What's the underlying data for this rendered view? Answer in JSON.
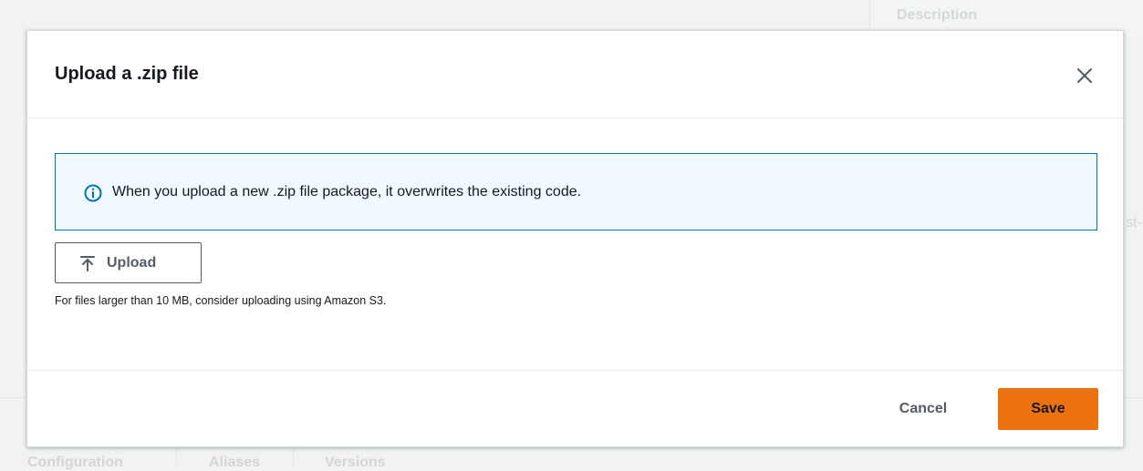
{
  "background": {
    "description_label": "Description",
    "side_text": "st-",
    "tabs": [
      "Configuration",
      "Aliases",
      "Versions"
    ]
  },
  "modal": {
    "title": "Upload a .zip file",
    "close_icon": "close-icon",
    "alert": {
      "icon": "info-icon",
      "text": "When you upload a new .zip file package, it overwrites the existing code.",
      "color": "#0073bb"
    },
    "upload_button": {
      "icon": "upload-icon",
      "label": "Upload"
    },
    "hint": "For files larger than 10 MB, consider uploading using Amazon S3.",
    "footer": {
      "cancel_label": "Cancel",
      "save_label": "Save",
      "save_color": "#ec7211"
    }
  }
}
